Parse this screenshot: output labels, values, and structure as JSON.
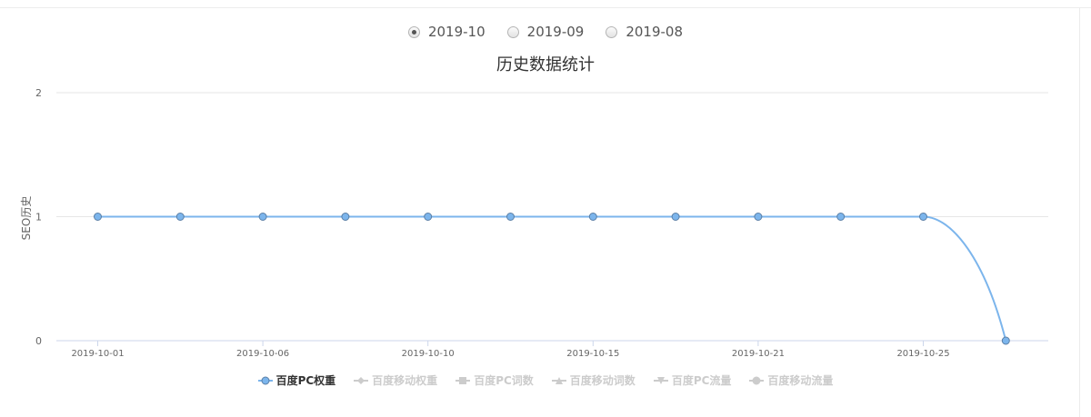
{
  "months": [
    {
      "label": "2019-10",
      "checked": true
    },
    {
      "label": "2019-09",
      "checked": false
    },
    {
      "label": "2019-08",
      "checked": false
    }
  ],
  "chart_data": {
    "type": "line",
    "title": "历史数据统计",
    "ylabel": "SEO历史",
    "xlabel": "",
    "ylim": [
      0,
      2
    ],
    "yticks": [
      "0",
      "1",
      "2"
    ],
    "x": [
      "2019-10-01",
      "2019-10-03",
      "2019-10-06",
      "2019-10-08",
      "2019-10-10",
      "2019-10-12",
      "2019-10-15",
      "2019-10-17",
      "2019-10-21",
      "2019-10-23",
      "2019-10-25",
      "2019-10-27"
    ],
    "xtick_labels": [
      "2019-10-01",
      "",
      "2019-10-06",
      "",
      "2019-10-10",
      "",
      "2019-10-15",
      "",
      "2019-10-21",
      "",
      "2019-10-25",
      ""
    ],
    "series": [
      {
        "name": "百度PC权重",
        "values": [
          1,
          1,
          1,
          1,
          1,
          1,
          1,
          1,
          1,
          1,
          1,
          0
        ],
        "color": "#7cb5ec",
        "visible": true,
        "marker": "circle"
      },
      {
        "name": "百度移动权重",
        "values": [],
        "color": "#cccccc",
        "visible": false,
        "marker": "diamond"
      },
      {
        "name": "百度PC词数",
        "values": [],
        "color": "#cccccc",
        "visible": false,
        "marker": "square"
      },
      {
        "name": "百度移动词数",
        "values": [],
        "color": "#cccccc",
        "visible": false,
        "marker": "triangle"
      },
      {
        "name": "百度PC流量",
        "values": [],
        "color": "#cccccc",
        "visible": false,
        "marker": "triangle-down"
      },
      {
        "name": "百度移动流量",
        "values": [],
        "color": "#cccccc",
        "visible": false,
        "marker": "circle"
      }
    ],
    "grid": true,
    "legend": "bottom"
  }
}
